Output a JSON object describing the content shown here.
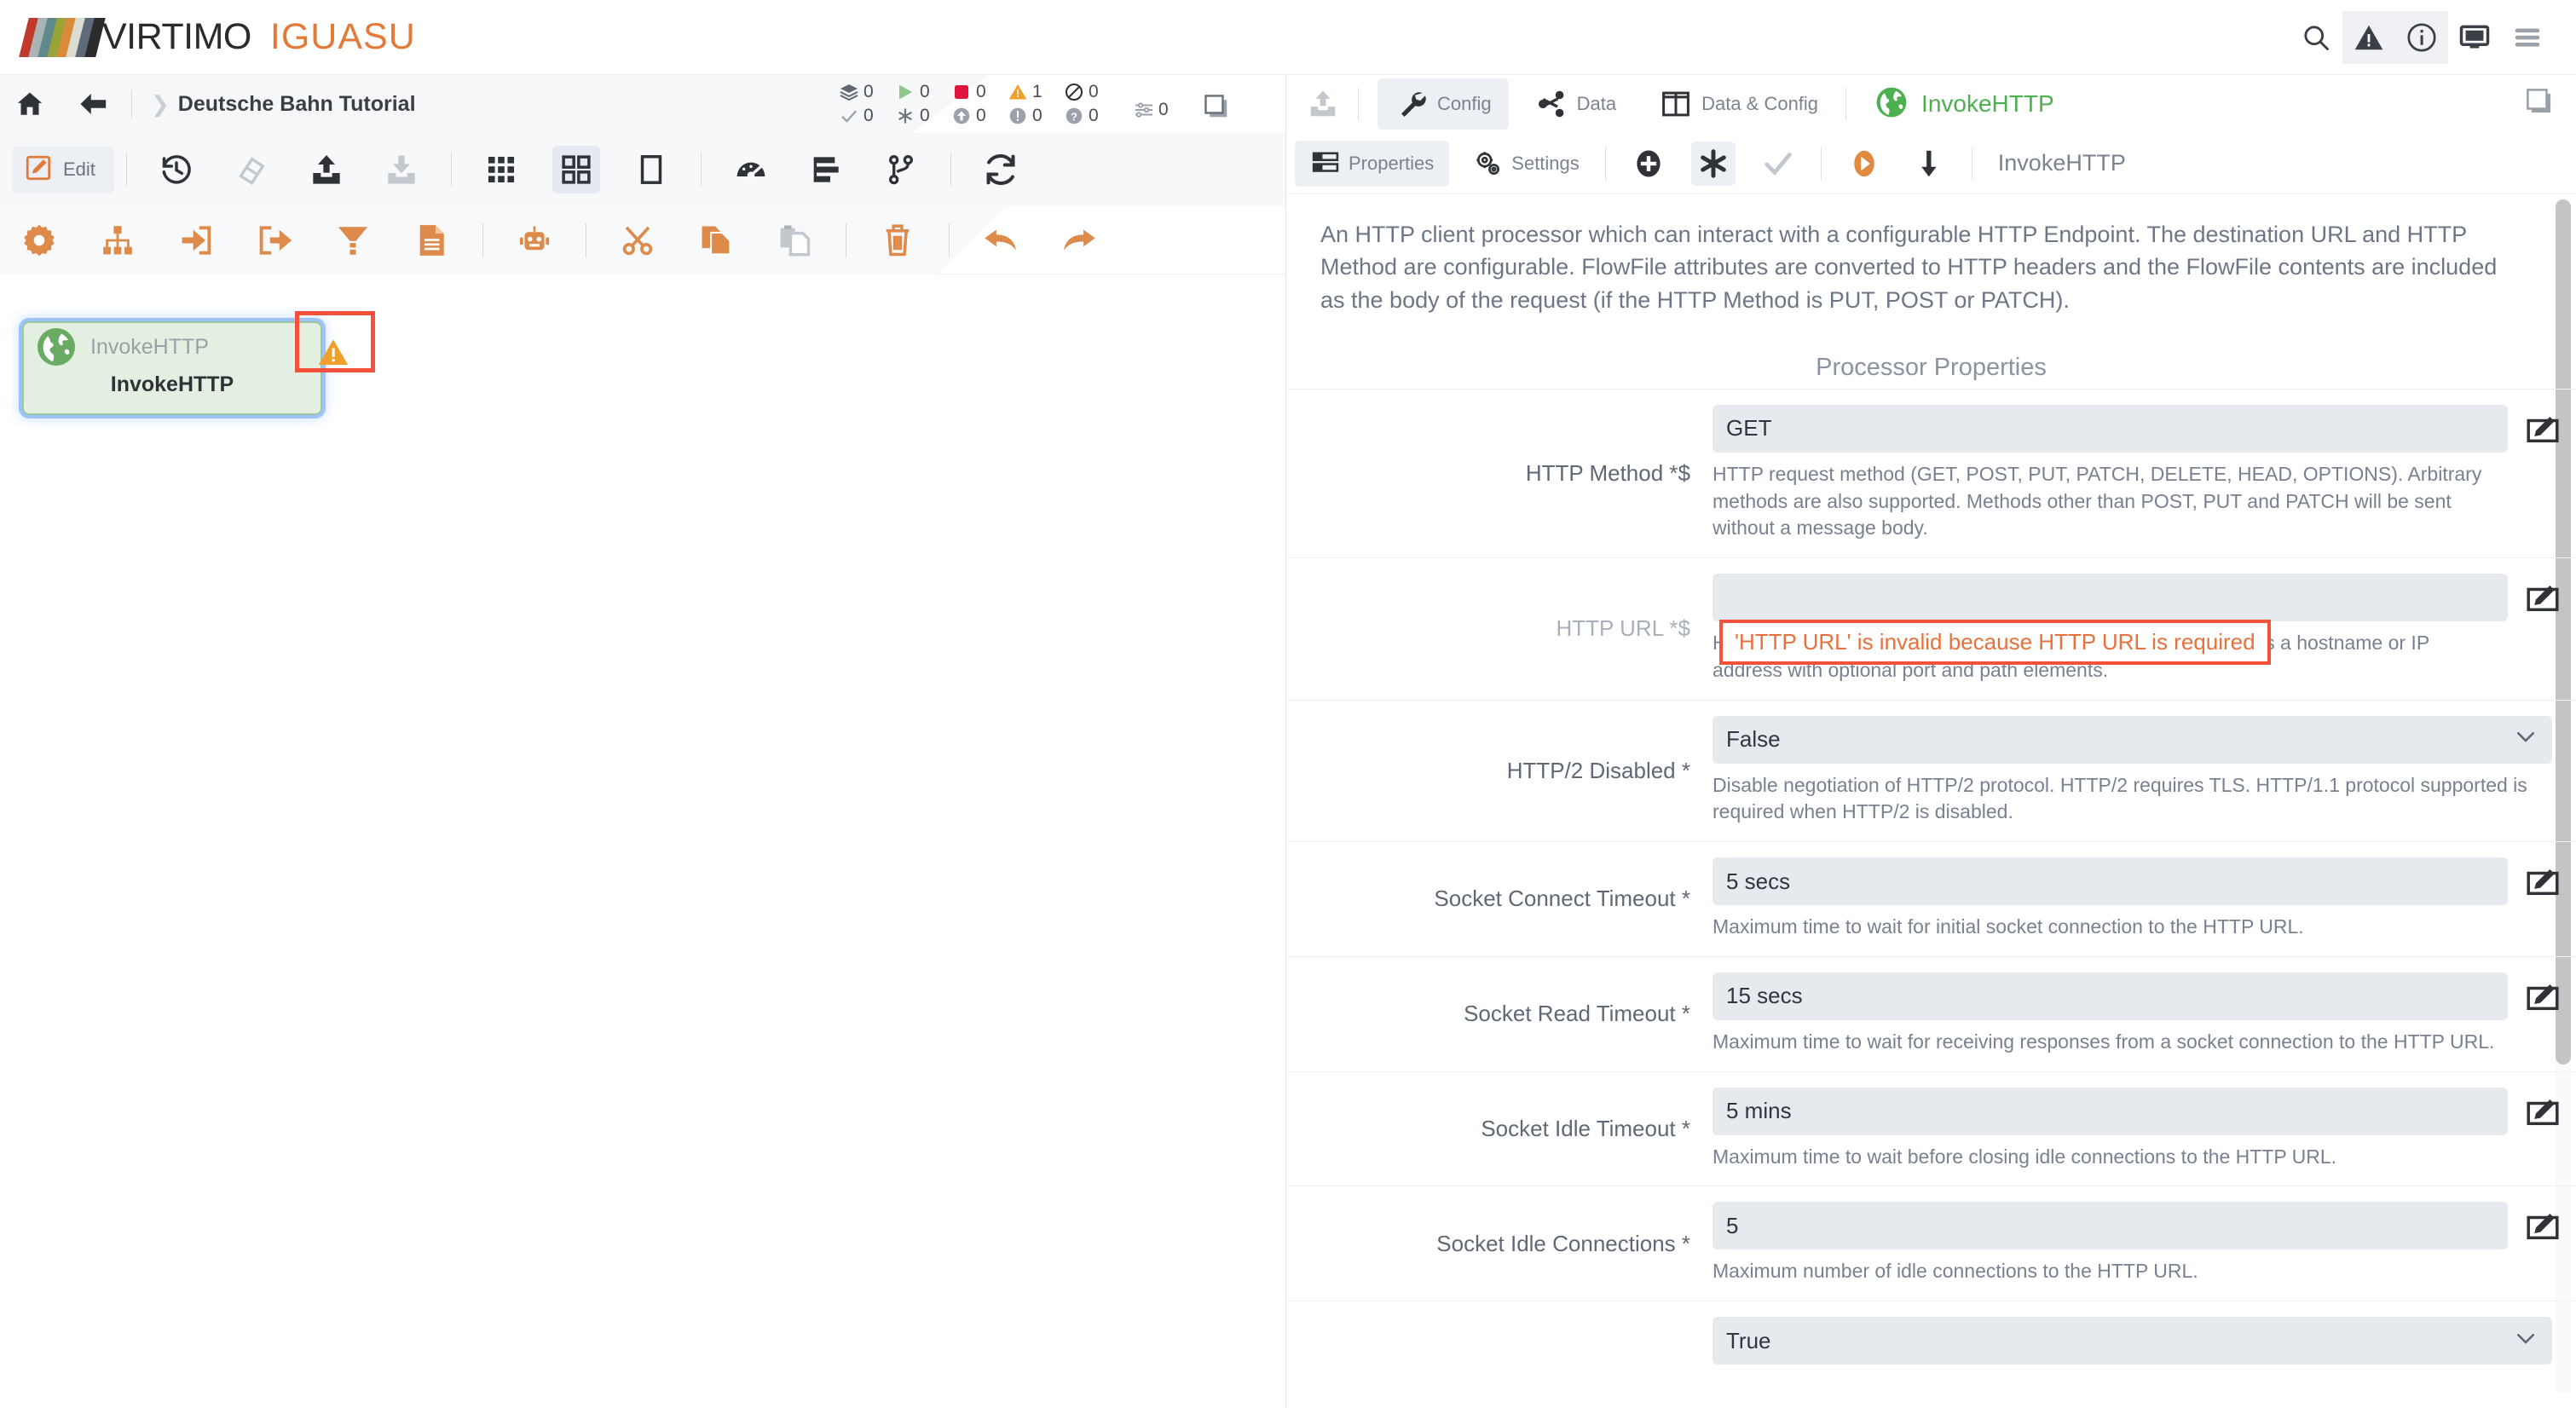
{
  "topbar": {
    "brand_primary": "VIRTIMO",
    "brand_secondary": "IGUASU",
    "brand_colors": [
      "#c0392b",
      "#9aa6a6",
      "#b3b9b3",
      "#5f8a8b",
      "#9aa33a",
      "#d98b3a",
      "#e07b39",
      "#c9c9c0",
      "#5d6b78",
      "#2b2b2b"
    ],
    "accent": "#e07b39",
    "icons": [
      {
        "name": "search-icon",
        "label": "Search"
      },
      {
        "name": "warning-triangle-icon",
        "label": "Bulletins"
      },
      {
        "name": "info-circle-icon",
        "label": "Info"
      },
      {
        "name": "monitor-icon",
        "label": "Display"
      },
      {
        "name": "hamburger-menu-icon",
        "label": "Menu"
      }
    ]
  },
  "breadcrumb": {
    "home_label": "Home",
    "back_label": "Back",
    "path": "Deutsche Bahn Tutorial"
  },
  "counters": {
    "row1": [
      {
        "icon": "layers-icon",
        "value": "0",
        "color": "#5f6873"
      },
      {
        "icon": "play-triangle-icon",
        "value": "0",
        "color": "#8cc98a"
      },
      {
        "icon": "stop-square-icon",
        "value": "0",
        "color": "#e0143c"
      },
      {
        "icon": "warning-triangle-icon",
        "value": "1",
        "color": "#f0a02a"
      },
      {
        "icon": "disabled-circle-icon",
        "value": "0",
        "color": "#3a3f47"
      }
    ],
    "row2": [
      {
        "icon": "check-icon",
        "value": "0",
        "color": "#9aa1aa"
      },
      {
        "icon": "asterisk-icon",
        "value": "0",
        "color": "#6d757f"
      },
      {
        "icon": "up-arrow-circle-icon",
        "value": "0",
        "color": "#9aa1aa"
      },
      {
        "icon": "exclamation-circle-icon",
        "value": "0",
        "color": "#9aa1aa"
      },
      {
        "icon": "question-circle-icon",
        "value": "0",
        "color": "#9aa1aa"
      }
    ],
    "sliders": {
      "icon": "sliders-icon",
      "value": "0"
    },
    "maximize": {
      "icon": "maximize-window-icon"
    }
  },
  "toolbar_primary": {
    "edit_label": "Edit",
    "items": [
      {
        "name": "history-icon",
        "label": "History"
      },
      {
        "name": "eraser-icon",
        "label": "Clear"
      },
      {
        "name": "upload-icon",
        "label": "Upload"
      },
      {
        "name": "download-icon",
        "label": "Download"
      },
      {
        "name": "grid-small-icon",
        "label": "Small grid"
      },
      {
        "name": "grid-large-icon",
        "label": "Large grid"
      },
      {
        "name": "square-outline-icon",
        "label": "Single view"
      },
      {
        "name": "gauge-icon",
        "label": "Dashboard"
      },
      {
        "name": "bar-list-icon",
        "label": "Statistics"
      },
      {
        "name": "branch-icon",
        "label": "Versions"
      },
      {
        "name": "refresh-icon",
        "label": "Refresh"
      }
    ]
  },
  "toolbar_secondary": {
    "items": [
      {
        "name": "gear-icon",
        "label": "Processor"
      },
      {
        "name": "process-group-icon",
        "label": "Process Group"
      },
      {
        "name": "input-port-icon",
        "label": "Input Port"
      },
      {
        "name": "output-port-icon",
        "label": "Output Port"
      },
      {
        "name": "funnel-icon",
        "label": "Funnel"
      },
      {
        "name": "template-icon",
        "label": "Template"
      },
      {
        "name": "robot-icon",
        "label": "Bot"
      },
      {
        "name": "scissors-icon",
        "label": "Cut"
      },
      {
        "name": "copy-icon",
        "label": "Copy"
      },
      {
        "name": "paste-icon",
        "label": "Paste"
      },
      {
        "name": "trash-icon",
        "label": "Delete"
      },
      {
        "name": "undo-icon",
        "label": "Undo"
      },
      {
        "name": "redo-icon",
        "label": "Redo"
      }
    ]
  },
  "canvas": {
    "node": {
      "type_label": "InvokeHTTP",
      "name_label": "InvokeHTTP",
      "icon": "globe-icon",
      "status_icon": "warning-triangle-icon",
      "highlight_color": "#f4503c",
      "selected": true
    }
  },
  "right_panel": {
    "upload_icon": "upload-icon",
    "tabs": [
      {
        "name": "tab-config",
        "label": "Config",
        "icon": "wrench-icon",
        "selected": true
      },
      {
        "name": "tab-data",
        "label": "Data",
        "icon": "share-nodes-icon",
        "selected": false
      },
      {
        "name": "tab-data-config",
        "label": "Data & Config",
        "icon": "split-panes-icon",
        "selected": false
      }
    ],
    "title": "InvokeHTTP",
    "title_icon": "globe-icon",
    "title_color": "#4caf50",
    "maximize_icon": "maximize-window-icon",
    "subtabs": [
      {
        "name": "subtab-properties",
        "label": "Properties",
        "icon": "properties-list-icon",
        "selected": true
      },
      {
        "name": "subtab-settings",
        "label": "Settings",
        "icon": "gears-icon",
        "selected": false
      }
    ],
    "sub_icons": [
      {
        "name": "add-property-icon",
        "label": "Add"
      },
      {
        "name": "asterisk-icon",
        "label": "Required",
        "selected": true
      },
      {
        "name": "check-icon",
        "label": "Validate"
      },
      {
        "name": "run-icon",
        "label": "Start",
        "color": "#e08a42"
      },
      {
        "name": "down-arrow-icon",
        "label": "Apply"
      }
    ],
    "processor_name": "InvokeHTTP",
    "description": "An HTTP client processor which can interact with a configurable HTTP Endpoint. The destination URL and HTTP Method are configurable. FlowFile attributes are converted to HTTP headers and the FlowFile contents are included as the body of the request (if the HTTP Method is PUT, POST or PATCH).",
    "properties_heading": "Processor Properties",
    "properties": [
      {
        "label": "HTTP Method *$",
        "value": "GET",
        "control": "text",
        "edit_icon": "pencil-edit-icon",
        "help": "HTTP request method (GET, POST, PUT, PATCH, DELETE, HEAD, OPTIONS). Arbitrary methods are also supported. Methods other than POST, PUT and PATCH will be sent without a message body."
      },
      {
        "label": "HTTP URL *$",
        "value": "",
        "control": "text",
        "edit_icon": "pencil-edit-icon",
        "error": "'HTTP URL' is invalid because HTTP URL is required",
        "help": "HTTP remote URL including a scheme of http or https, as well as a hostname or IP address with optional port and path elements."
      },
      {
        "label": "HTTP/2 Disabled *",
        "value": "False",
        "control": "select",
        "chevron_icon": "chevron-down-icon",
        "help": "Disable negotiation of HTTP/2 protocol. HTTP/2 requires TLS. HTTP/1.1 protocol supported is required when HTTP/2 is disabled."
      },
      {
        "label": "Socket Connect Timeout *",
        "value": "5 secs",
        "control": "text",
        "edit_icon": "pencil-edit-icon",
        "help": "Maximum time to wait for initial socket connection to the HTTP URL."
      },
      {
        "label": "Socket Read Timeout *",
        "value": "15 secs",
        "control": "text",
        "edit_icon": "pencil-edit-icon",
        "help": "Maximum time to wait for receiving responses from a socket connection to the HTTP URL."
      },
      {
        "label": "Socket Idle Timeout *",
        "value": "5 mins",
        "control": "text",
        "edit_icon": "pencil-edit-icon",
        "help": "Maximum time to wait before closing idle connections to the HTTP URL."
      },
      {
        "label": "Socket Idle Connections *",
        "value": "5",
        "control": "text",
        "edit_icon": "pencil-edit-icon",
        "help": "Maximum number of idle connections to the HTTP URL."
      },
      {
        "label": "",
        "value": "True",
        "control": "select",
        "chevron_icon": "chevron-down-icon",
        "help": ""
      }
    ]
  }
}
